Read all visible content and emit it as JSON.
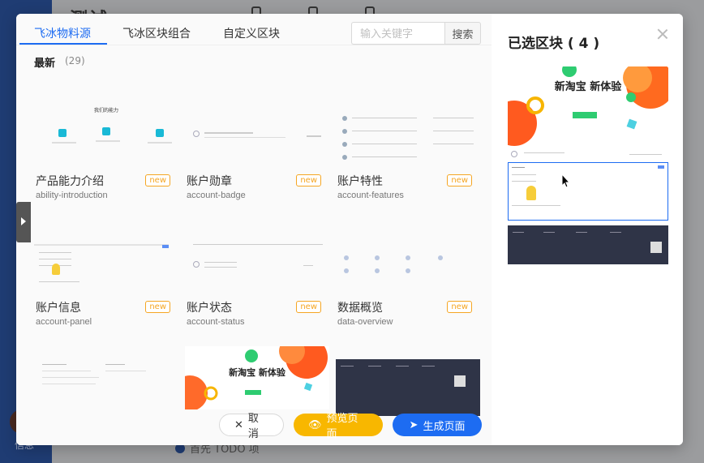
{
  "background": {
    "page_title": "测试",
    "side_text": "信息",
    "footer_text": "首先 TODO 项"
  },
  "tabs": [
    {
      "label": "飞冰物料源",
      "active": true
    },
    {
      "label": "飞冰区块组合",
      "active": false
    },
    {
      "label": "自定义区块",
      "active": false
    }
  ],
  "search": {
    "placeholder": "输入关键字",
    "button_label": "搜索"
  },
  "section": {
    "title": "最新",
    "count": "(29)"
  },
  "cards": [
    {
      "title": "产品能力介绍",
      "sub": "ability-introduction",
      "badge": "new",
      "thumb_heading": "我们的能力"
    },
    {
      "title": "账户勋章",
      "sub": "account-badge",
      "badge": "new"
    },
    {
      "title": "账户特性",
      "sub": "account-features",
      "badge": "new"
    },
    {
      "title": "账户信息",
      "sub": "account-panel",
      "badge": "new"
    },
    {
      "title": "账户状态",
      "sub": "account-status",
      "badge": "new"
    },
    {
      "title": "数据概览",
      "sub": "data-overview",
      "badge": "new"
    },
    {
      "title": "",
      "sub": "",
      "badge": ""
    },
    {
      "title": "",
      "sub": "",
      "badge": "",
      "thumb_heading": "新淘宝 新体验"
    },
    {
      "title": "",
      "sub": "",
      "badge": ""
    }
  ],
  "buttons": {
    "cancel": "取消",
    "preview": "预览页面",
    "generate": "生成页面"
  },
  "selected": {
    "title": "已选区块 ( 4 )",
    "banner_heading": "新淘宝 新体验"
  },
  "colors": {
    "primary": "#1d6cf2",
    "warning": "#f8b700",
    "badge": "#f5a623",
    "footer_dark": "#2f3447"
  }
}
